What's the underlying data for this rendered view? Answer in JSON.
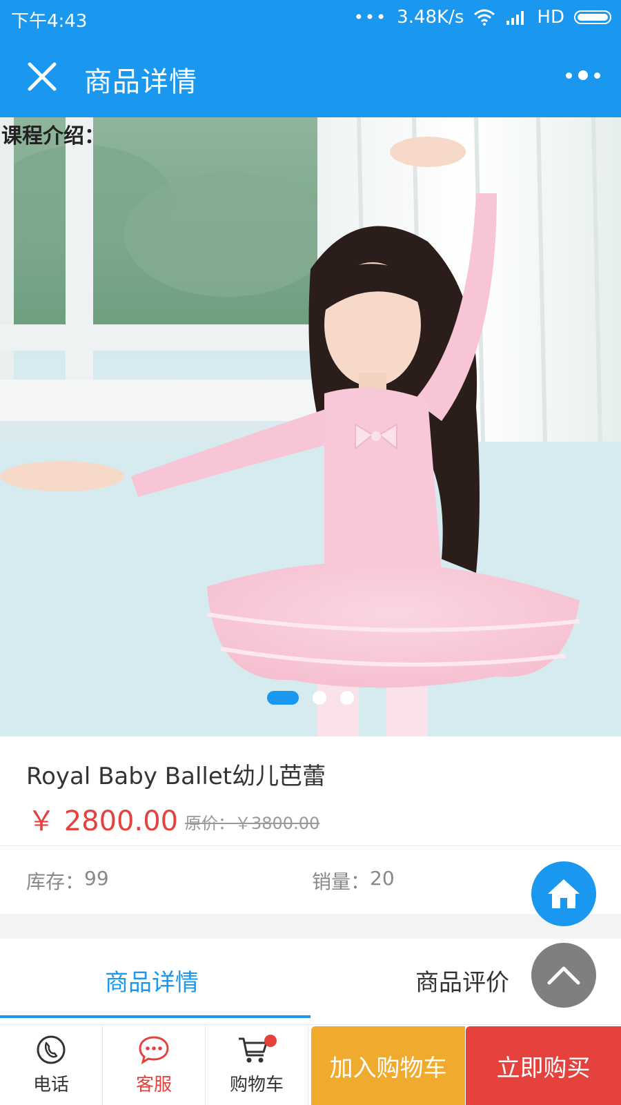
{
  "status_bar": {
    "time": "下午4:43",
    "network_speed": "3.48K/s",
    "network_type": "HD"
  },
  "header": {
    "title": "商品详情"
  },
  "banner": {
    "intro_label": "课程介绍：",
    "slides_total": 3,
    "active_slide": 1
  },
  "product": {
    "name": "Royal Baby Ballet幼儿芭蕾",
    "price": "￥ 2800.00",
    "original_price": "原价：￥3800.00"
  },
  "stats": {
    "stock_label": "库存：",
    "stock_value": "99",
    "sales_label": "销量：",
    "sales_value": "20"
  },
  "tabs": [
    {
      "label": "商品详情",
      "active": true
    },
    {
      "label": "商品评价",
      "active": false
    }
  ],
  "bottom_bar": {
    "phone_label": "电话",
    "service_label": "客服",
    "cart_label": "购物车",
    "add_to_cart_label": "加入购物车",
    "buy_now_label": "立即购买"
  },
  "colors": {
    "primary": "#1a98f0",
    "price_red": "#e5423d",
    "add_cart_orange": "#f0ab2f",
    "fab_gray": "#7f7f7f"
  }
}
